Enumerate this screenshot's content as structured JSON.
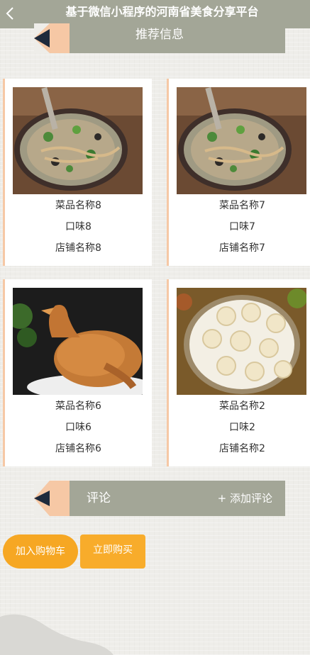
{
  "header": {
    "title": "基于微信小程序的河南省美食分享平台"
  },
  "recommend": {
    "title": "推荐信息"
  },
  "dishes": [
    {
      "name": "菜品名称8",
      "taste": "口味8",
      "shop": "店铺名称8",
      "image": "noodle-soup"
    },
    {
      "name": "菜品名称7",
      "taste": "口味7",
      "shop": "店铺名称7",
      "image": "noodle-soup"
    },
    {
      "name": "菜品名称6",
      "taste": "口味6",
      "shop": "店铺名称6",
      "image": "roast-chicken"
    },
    {
      "name": "菜品名称2",
      "taste": "口味2",
      "shop": "店铺名称2",
      "image": "soup-dumplings"
    }
  ],
  "comments": {
    "title": "评论",
    "add_label": "+ 添加评论"
  },
  "actions": {
    "add_to_cart": "加入购物车",
    "buy_now": "立即购买"
  },
  "colors": {
    "header_bg": "#a3a697",
    "button_orange": "#f6a723",
    "card_border": "#f6c8a5"
  }
}
